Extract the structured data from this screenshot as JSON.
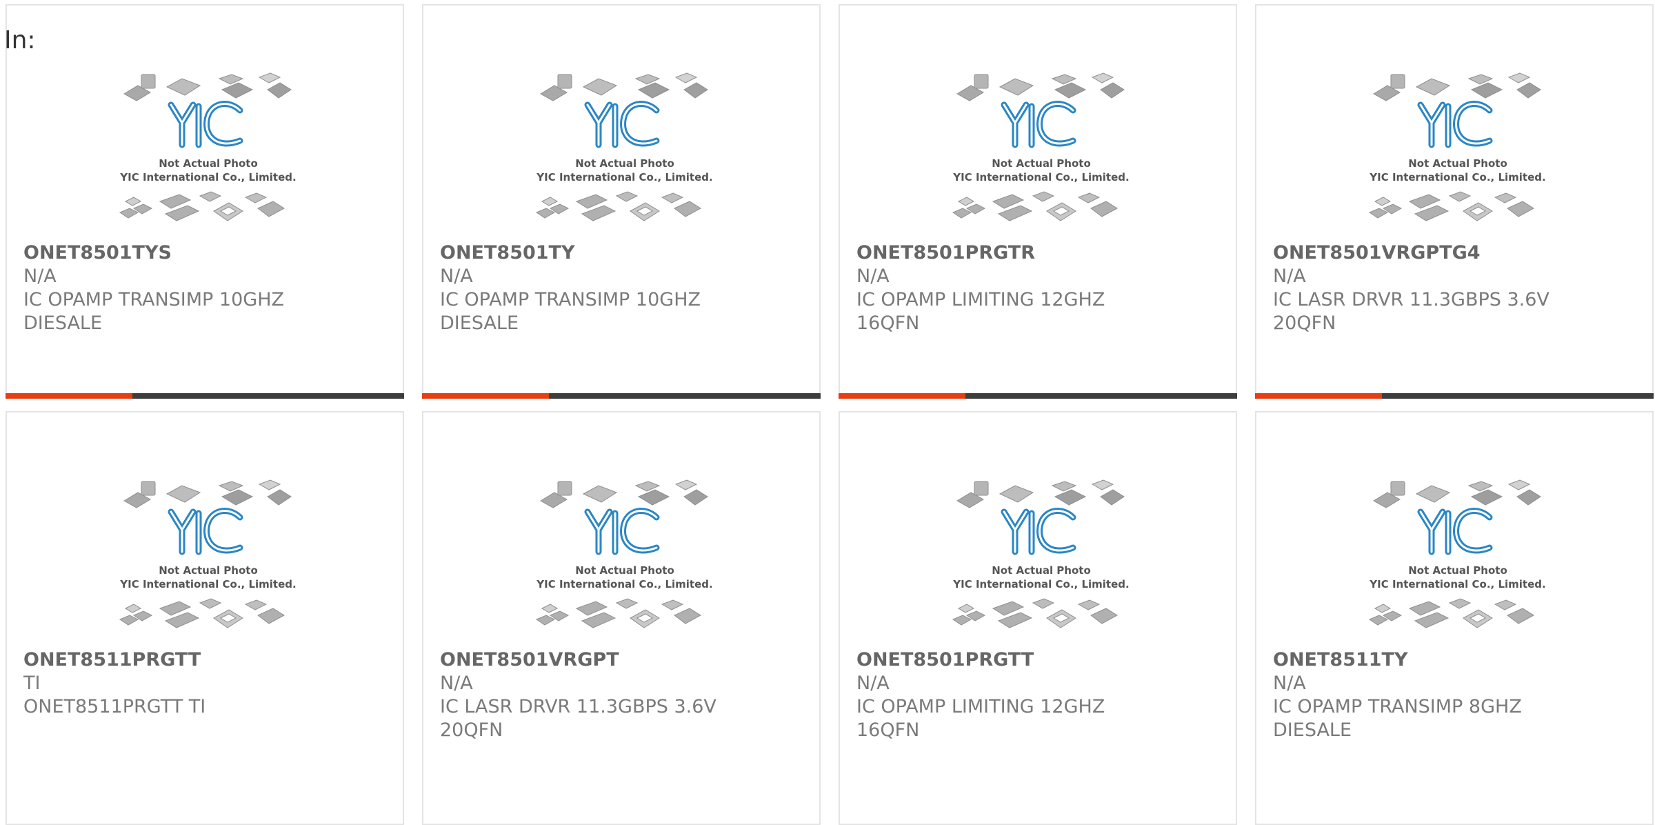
{
  "header": {
    "in_label": "In:"
  },
  "placeholder": {
    "line1": "Not Actual Photo",
    "line2": "YIC International Co., Limited.",
    "logo_text": "YIC"
  },
  "colors": {
    "accent": "#e63d12",
    "bar": "#3d3d3d",
    "logo_blue": "#2a86c5",
    "text_gray": "#7a7a7a"
  },
  "products": [
    {
      "part": "ONET8501TYS",
      "mfr": "N/A",
      "desc1": "IC OPAMP TRANSIMP 10GHZ",
      "desc2": "DIESALE"
    },
    {
      "part": "ONET8501TY",
      "mfr": "N/A",
      "desc1": "IC OPAMP TRANSIMP 10GHZ",
      "desc2": "DIESALE"
    },
    {
      "part": "ONET8501PRGTR",
      "mfr": "N/A",
      "desc1": "IC OPAMP LIMITING 12GHZ",
      "desc2": "16QFN"
    },
    {
      "part": "ONET8501VRGPTG4",
      "mfr": "N/A",
      "desc1": "IC LASR DRVR 11.3GBPS 3.6V",
      "desc2": "20QFN"
    },
    {
      "part": "ONET8511PRGTT",
      "mfr": "TI",
      "desc1": "ONET8511PRGTT TI",
      "desc2": ""
    },
    {
      "part": "ONET8501VRGPT",
      "mfr": "N/A",
      "desc1": "IC LASR DRVR 11.3GBPS 3.6V",
      "desc2": "20QFN"
    },
    {
      "part": "ONET8501PRGTT",
      "mfr": "N/A",
      "desc1": "IC OPAMP LIMITING 12GHZ",
      "desc2": "16QFN"
    },
    {
      "part": "ONET8511TY",
      "mfr": "N/A",
      "desc1": "IC OPAMP TRANSIMP 8GHZ",
      "desc2": "DIESALE"
    }
  ]
}
